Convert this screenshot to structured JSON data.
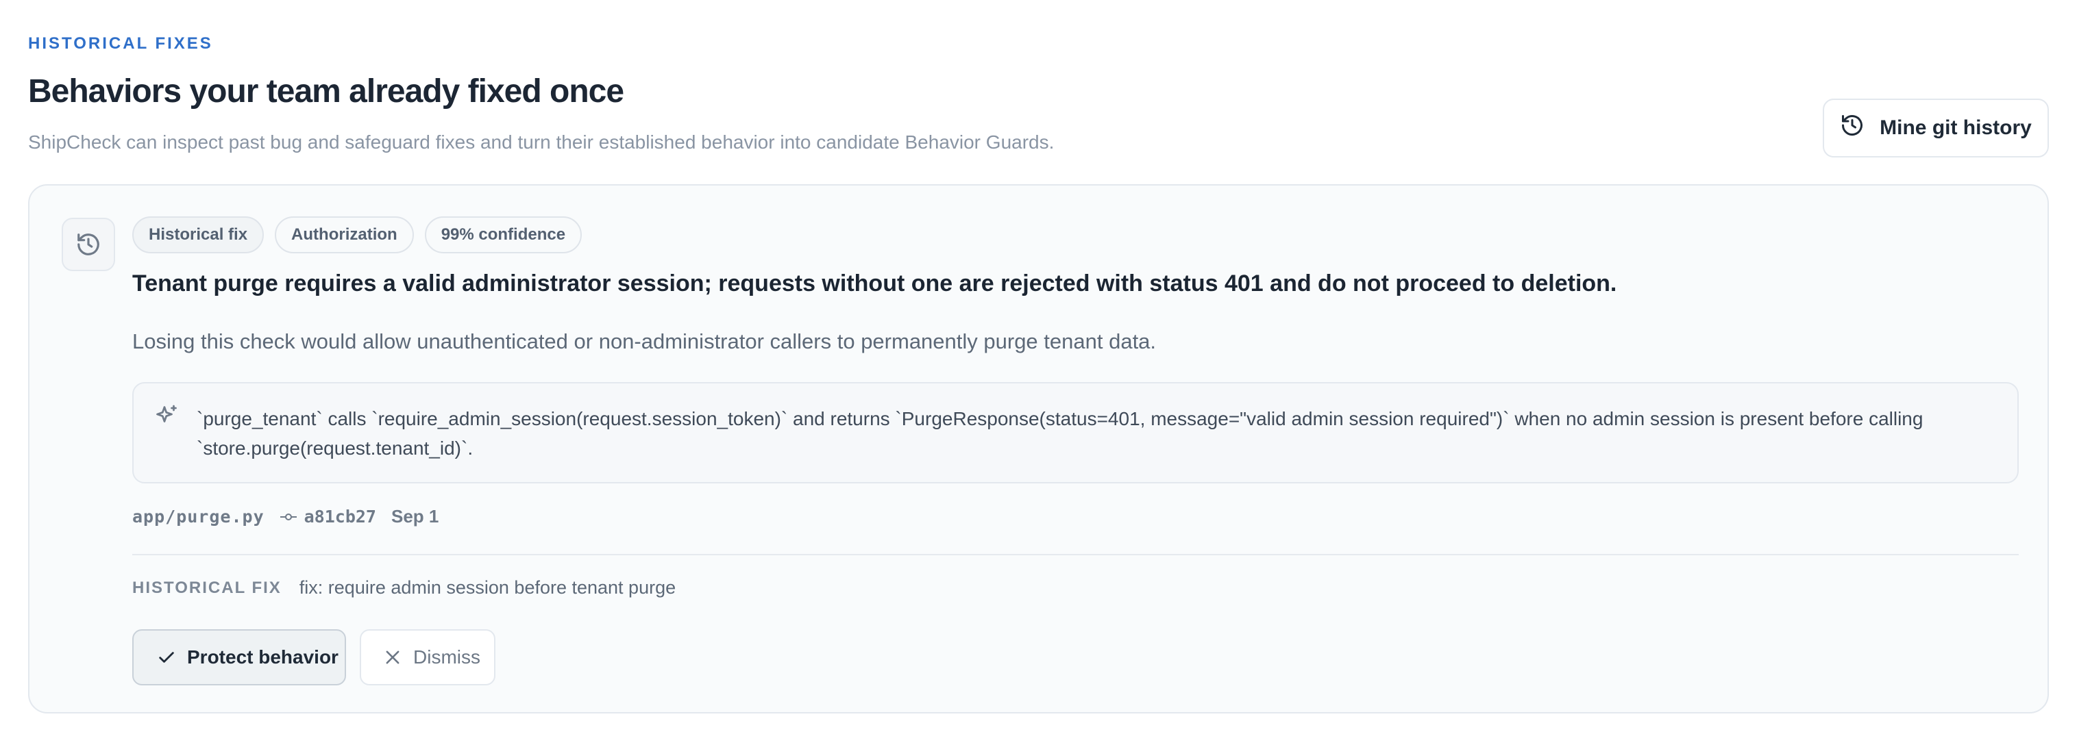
{
  "header": {
    "eyebrow": "HISTORICAL FIXES",
    "title": "Behaviors your team already fixed once",
    "subtitle": "ShipCheck can inspect past bug and safeguard fixes and turn their established behavior into candidate Behavior Guards.",
    "mine_button_label": "Mine git history",
    "mine_button_icon": "history-icon"
  },
  "card": {
    "icon": "history-icon",
    "tags": [
      "Historical fix",
      "Authorization",
      "99% confidence"
    ],
    "headline": "Tenant purge requires a valid administrator session; requests without one are rejected with status 401 and do not proceed to deletion.",
    "risk": "Losing this check would allow unauthenticated or non-administrator callers to permanently purge tenant data.",
    "evidence": {
      "icon": "sparkles-icon",
      "text": "`purge_tenant` calls `require_admin_session(request.session_token)` and returns `PurgeResponse(status=401, message=\"valid admin session required\")` when no admin session is present before calling `store.purge(request.tenant_id)`."
    },
    "meta": {
      "file": "app/purge.py",
      "commit_icon": "git-commit-icon",
      "commit": "a81cb27",
      "date": "Sep 1"
    },
    "historical_fix": {
      "label": "HISTORICAL FIX",
      "message": "fix: require admin session before tenant purge"
    },
    "actions": {
      "protect_label": "Protect behavior",
      "protect_icon": "check-icon",
      "dismiss_label": "Dismiss",
      "dismiss_icon": "close-icon"
    }
  },
  "colors": {
    "accent": "#2f6fc9",
    "text_primary": "#1c2634",
    "text_muted": "#8994a3",
    "border": "#e3e8ee",
    "card_background": "#f9fbfc"
  }
}
